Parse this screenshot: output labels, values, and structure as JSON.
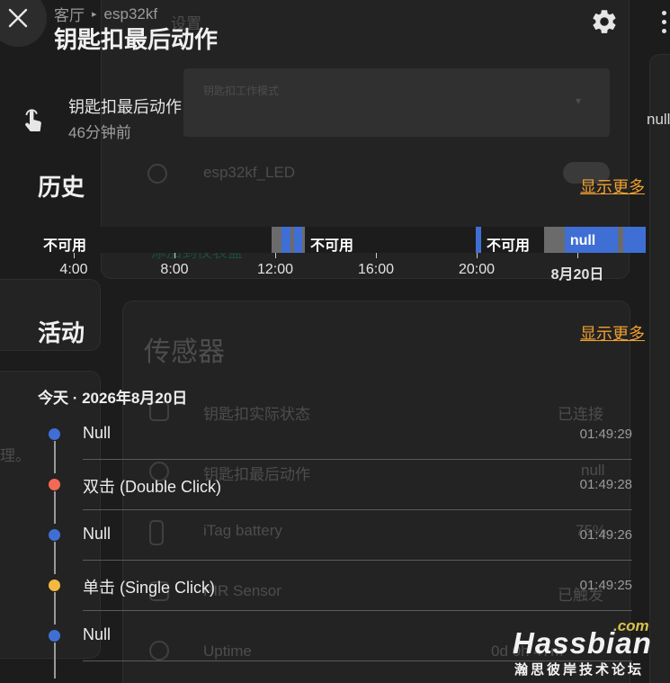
{
  "background": {
    "top_label": "设置",
    "select_label": "钥匙扣工作模式",
    "led_label": "esp32kf_LED",
    "add_link": "添加到仪表盘",
    "sensors_title": "传感器",
    "sensors": [
      {
        "name": "钥匙扣实际状态",
        "value": "已连接"
      },
      {
        "name": "钥匙扣最后动作",
        "value": "null"
      },
      {
        "name": "iTag battery",
        "value": "75%"
      },
      {
        "name": "PIR Sensor",
        "value": "已触发"
      },
      {
        "name": "Uptime",
        "value": "0d 0h 47m"
      }
    ],
    "left_fragment": "理。"
  },
  "dialog": {
    "close_icon": "close-icon",
    "breadcrumb": {
      "area": "客厅",
      "device": "esp32kf"
    },
    "title": "钥匙扣最后动作",
    "settings_icon": "gear-icon",
    "menu_icon": "dots-vertical-icon",
    "right_state": "null",
    "state": {
      "icon": "gesture-tap-icon",
      "name": "钥匙扣最后动作",
      "changed": "46分钟前"
    },
    "history": {
      "title": "历史",
      "show_more": "显示更多",
      "segments": [
        {
          "label": "不可用",
          "color": "#1c1c1c",
          "start": 0.0,
          "end": 0.387
        },
        {
          "label": "",
          "color": "#6b6b6b",
          "start": 0.387,
          "end": 0.402
        },
        {
          "label": "",
          "color": "#3f6fd4",
          "start": 0.402,
          "end": 0.418
        },
        {
          "label": "",
          "color": "#6b6b6b",
          "start": 0.418,
          "end": 0.424
        },
        {
          "label": "",
          "color": "#3f6fd4",
          "start": 0.424,
          "end": 0.436
        },
        {
          "label": "",
          "color": "#6b6b6b",
          "start": 0.436,
          "end": 0.441
        },
        {
          "label": "不可用",
          "color": "#1c1c1c",
          "start": 0.441,
          "end": 0.721
        },
        {
          "label": "",
          "color": "#3f6fd4",
          "start": 0.721,
          "end": 0.73
        },
        {
          "label": "不可用",
          "color": "#1c1c1c",
          "start": 0.73,
          "end": 0.833
        },
        {
          "label": "",
          "color": "#6b6b6b",
          "start": 0.833,
          "end": 0.867
        },
        {
          "label": "null",
          "color": "#3f6fd4",
          "start": 0.867,
          "end": 0.955
        },
        {
          "label": "",
          "color": "#6b6b6b",
          "start": 0.955,
          "end": 0.963
        },
        {
          "label": "",
          "color": "#3f6fd4",
          "start": 0.963,
          "end": 1.0
        }
      ],
      "axis_ticks": [
        {
          "label": "4:00",
          "bold": false
        },
        {
          "label": "8:00",
          "bold": false
        },
        {
          "label": "12:00",
          "bold": false
        },
        {
          "label": "16:00",
          "bold": false
        },
        {
          "label": "20:00",
          "bold": false
        },
        {
          "label": "8月20日",
          "bold": true
        }
      ]
    },
    "activity": {
      "title": "活动",
      "show_more": "显示更多",
      "date": "今天 · 2026年8月20日",
      "items": [
        {
          "label": "Null",
          "time": "01:49:29",
          "color": "#3f6fd4"
        },
        {
          "label": "双击 (Double Click)",
          "time": "01:49:28",
          "color": "#f26a55"
        },
        {
          "label": "Null",
          "time": "01:49:26",
          "color": "#3f6fd4"
        },
        {
          "label": "单击 (Single Click)",
          "time": "01:49:25",
          "color": "#f4b940"
        },
        {
          "label": "Null",
          "time": "",
          "color": "#3f6fd4"
        }
      ]
    }
  },
  "watermark": {
    "com": ".com",
    "name": "Hassbian",
    "subtitle": "瀚思彼岸技术论坛"
  }
}
